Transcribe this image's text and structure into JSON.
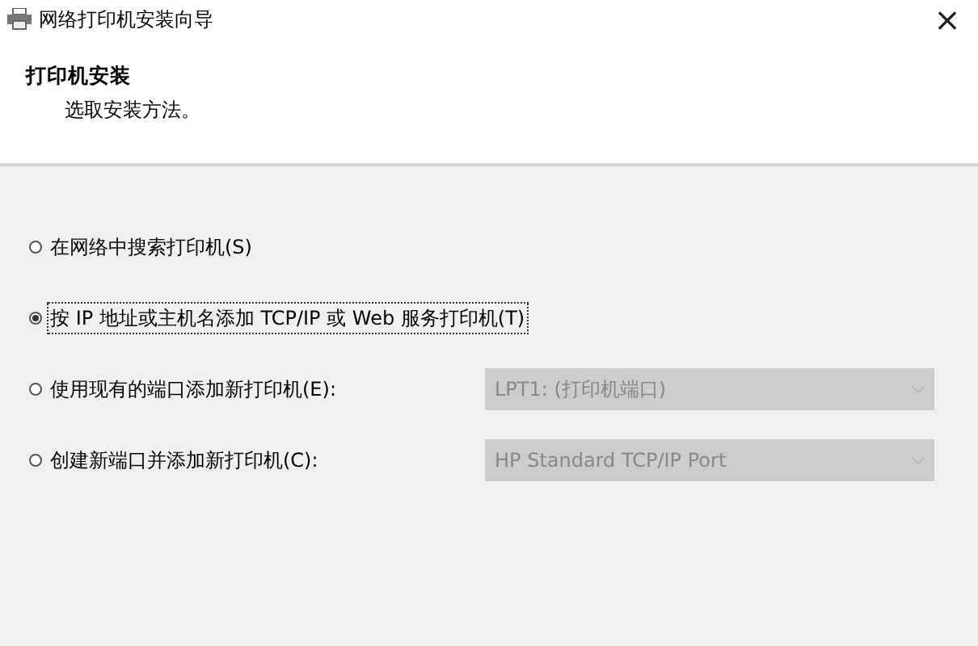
{
  "window": {
    "title": "网络打印机安装向导",
    "close": "×"
  },
  "header": {
    "title": "打印机安装",
    "subtitle": "选取安装方法。"
  },
  "options": [
    {
      "label": "在网络中搜索打印机(S)",
      "selected": false
    },
    {
      "label": "按 IP 地址或主机名添加 TCP/IP 或 Web 服务打印机(T)",
      "selected": true
    },
    {
      "label": "使用现有的端口添加新打印机(E):",
      "selected": false,
      "port": {
        "value": "LPT1: (打印机端口)",
        "disabled": true
      }
    },
    {
      "label": "创建新端口并添加新打印机(C):",
      "selected": false,
      "port": {
        "value": "HP Standard TCP/IP Port",
        "disabled": true
      }
    }
  ]
}
